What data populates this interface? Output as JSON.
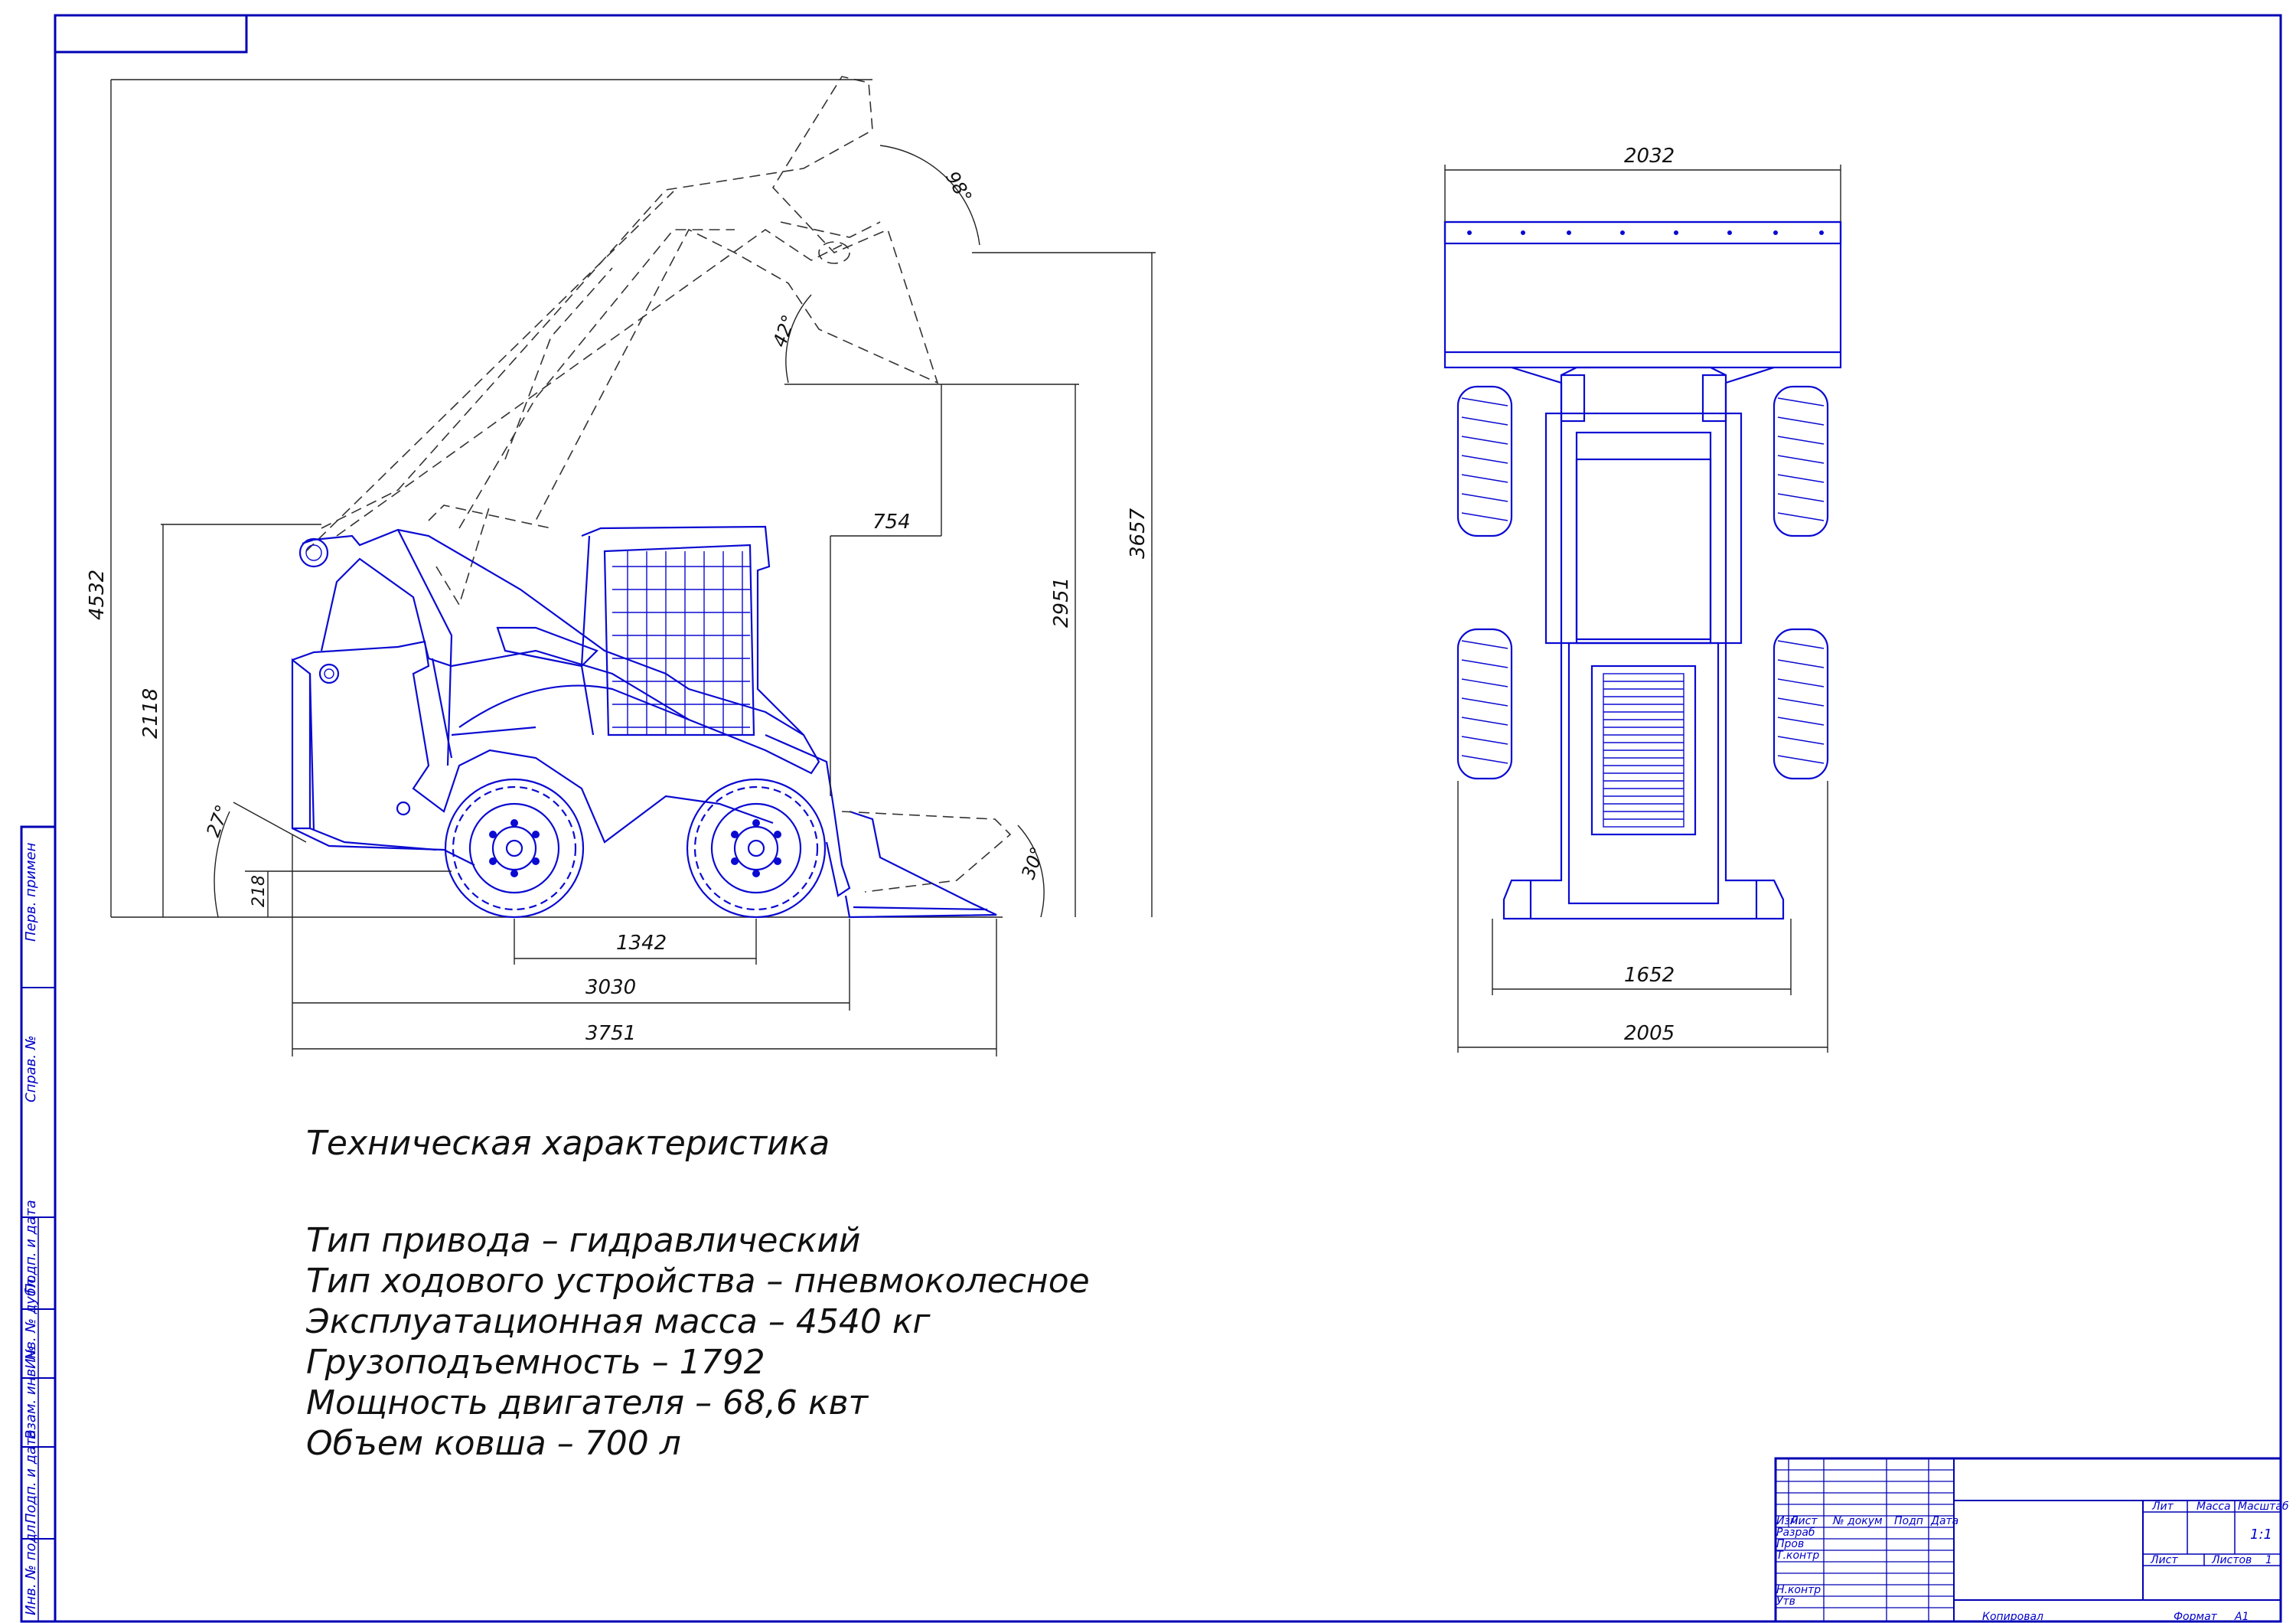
{
  "dimensions_side": {
    "height_max": "4532",
    "height_pin": "3657",
    "height_dump": "2951",
    "reach": "754",
    "dump_angle": "98°",
    "rollback_angle": "42°",
    "height_overall": "2118",
    "ground_clear": "218",
    "departure_angle": "27°",
    "bucket_angle": "30°",
    "wheelbase": "1342",
    "length_no_bucket": "3030",
    "length_total": "3751"
  },
  "dimensions_top": {
    "bucket_width": "2032",
    "track_width": "1652",
    "overall_width": "2005"
  },
  "specs": {
    "title": "Техническая характеристика",
    "lines": [
      "Тип привода – гидравлический",
      "Тип ходового устройства – пневмоколесное",
      "Эксплуатационная масса – 4540 кг",
      "Грузоподъемность – 1792",
      "Мощность двигателя – 68,6 квт",
      "Объем ковша – 700 л"
    ]
  },
  "side_stamp": [
    "Перв. примен",
    "Справ. №",
    "Подп. и дата",
    "Инв. № дубл.",
    "Взам. инв. №",
    "Подп. и дата",
    "Инв. № подл."
  ],
  "title_block": {
    "header": [
      "Изм",
      "Лист",
      "№ докум",
      "Подп",
      "Дата"
    ],
    "rows": [
      "Разраб",
      "Пров",
      "Т.контр",
      "Н.контр",
      "Утв"
    ],
    "lit": "Лит",
    "mass": "Масса",
    "scale": "Масштаб",
    "scale_value": "1:1",
    "sheet": "Лист",
    "sheets": "Листов",
    "sheets_value": "1",
    "copied": "Копировал",
    "format": "Формат",
    "format_value": "A1"
  }
}
